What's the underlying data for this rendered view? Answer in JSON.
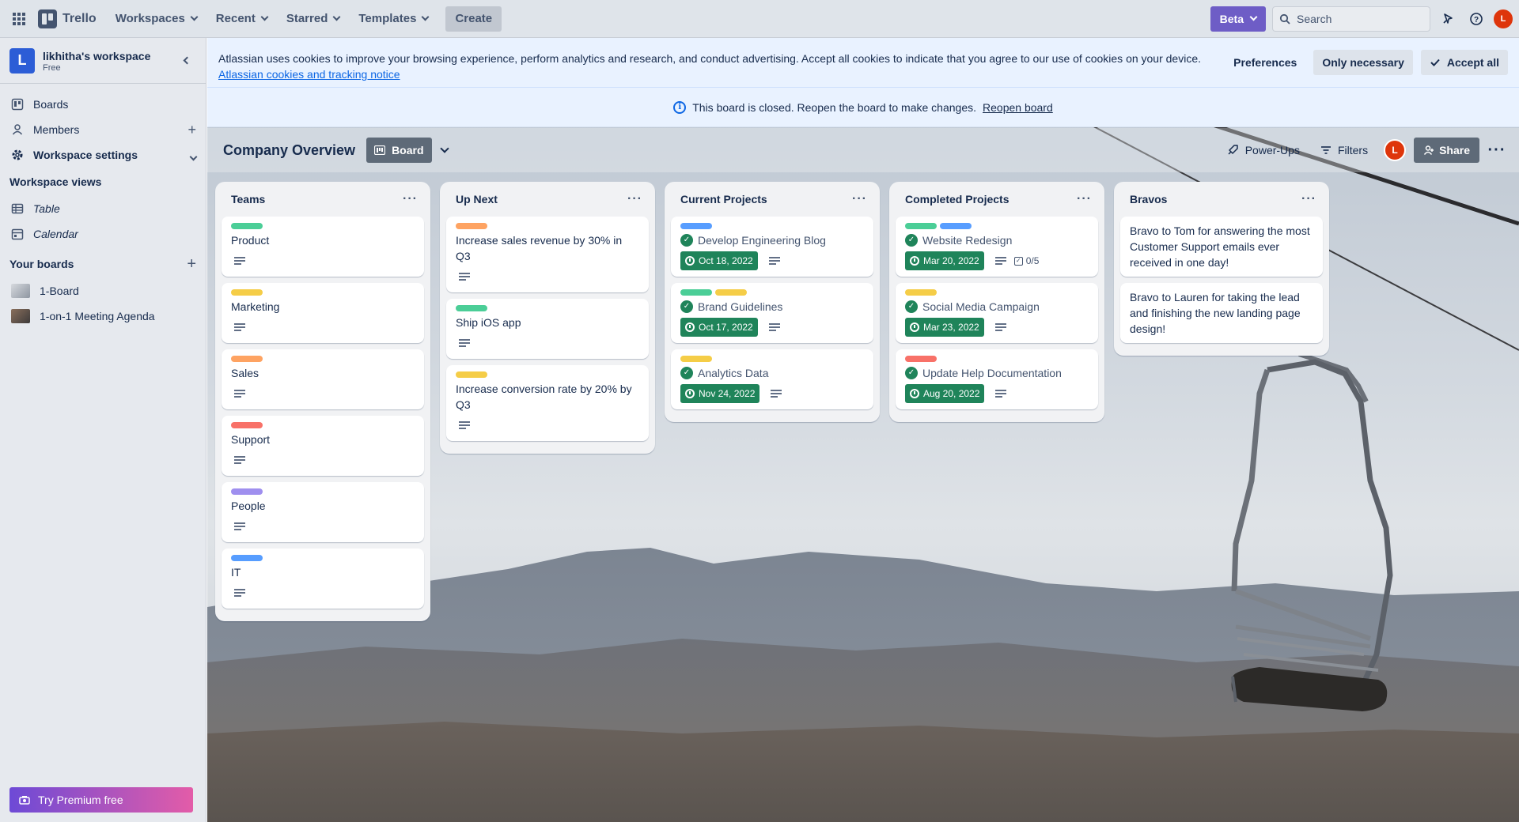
{
  "topbar": {
    "app_name": "Trello",
    "nav": [
      "Workspaces",
      "Recent",
      "Starred",
      "Templates"
    ],
    "create_label": "Create",
    "beta_label": "Beta",
    "search_placeholder": "Search",
    "avatar_initial": "L"
  },
  "sidebar": {
    "workspace_initial": "L",
    "workspace_name": "likhitha's workspace",
    "workspace_plan": "Free",
    "items": [
      {
        "label": "Boards"
      },
      {
        "label": "Members"
      },
      {
        "label": "Workspace settings"
      }
    ],
    "views_heading": "Workspace views",
    "views": [
      {
        "label": "Table"
      },
      {
        "label": "Calendar"
      }
    ],
    "boards_heading": "Your boards",
    "boards": [
      {
        "label": "1-Board"
      },
      {
        "label": "1-on-1 Meeting Agenda"
      }
    ],
    "premium_label": "Try Premium free"
  },
  "cookie": {
    "text": "Atlassian uses cookies to improve your browsing experience, perform analytics and research, and conduct advertising. Accept all cookies to indicate that you agree to our use of cookies on your device.",
    "link": "Atlassian cookies and tracking notice",
    "preferences": "Preferences",
    "only_necessary": "Only necessary",
    "accept_all": "Accept all"
  },
  "closed_banner": {
    "text": "This board is closed. Reopen the board to make changes.",
    "link": "Reopen board"
  },
  "board": {
    "title": "Company Overview",
    "view_label": "Board",
    "powerups": "Power-Ups",
    "filters": "Filters",
    "share": "Share"
  },
  "colors": {
    "green": "#4bce97",
    "yellow": "#f5cd47",
    "orange": "#fea362",
    "red": "#f87168",
    "purple": "#9f8fef",
    "blue": "#579dff",
    "due_complete": "#1f845a"
  },
  "lists": [
    {
      "title": "Teams",
      "cards": [
        {
          "title": "Product",
          "labels": [
            "#4bce97"
          ]
        },
        {
          "title": "Marketing",
          "labels": [
            "#f5cd47"
          ]
        },
        {
          "title": "Sales",
          "labels": [
            "#fea362"
          ]
        },
        {
          "title": "Support",
          "labels": [
            "#f87168"
          ]
        },
        {
          "title": "People",
          "labels": [
            "#9f8fef"
          ]
        },
        {
          "title": "IT",
          "labels": [
            "#579dff"
          ]
        }
      ]
    },
    {
      "title": "Up Next",
      "cards": [
        {
          "title": "Increase sales revenue by 30% in Q3",
          "labels": [
            "#fea362"
          ]
        },
        {
          "title": "Ship iOS app",
          "labels": [
            "#4bce97"
          ]
        },
        {
          "title": "Increase conversion rate by 20% by Q3",
          "labels": [
            "#f5cd47"
          ]
        }
      ]
    },
    {
      "title": "Current Projects",
      "cards": [
        {
          "title": "Develop Engineering Blog",
          "labels": [
            "#579dff"
          ],
          "done": true,
          "due": "Oct 18, 2022"
        },
        {
          "title": "Brand Guidelines",
          "labels": [
            "#4bce97",
            "#f5cd47"
          ],
          "done": true,
          "due": "Oct 17, 2022"
        },
        {
          "title": "Analytics Data",
          "labels": [
            "#f5cd47"
          ],
          "done": true,
          "due": "Nov 24, 2022"
        }
      ]
    },
    {
      "title": "Completed Projects",
      "cards": [
        {
          "title": "Website Redesign",
          "labels": [
            "#4bce97",
            "#579dff"
          ],
          "done": true,
          "due": "Mar 20, 2022",
          "checklist": "0/5"
        },
        {
          "title": "Social Media Campaign",
          "labels": [
            "#f5cd47"
          ],
          "done": true,
          "due": "Mar 23, 2022"
        },
        {
          "title": "Update Help Documentation",
          "labels": [
            "#f87168"
          ],
          "done": true,
          "due": "Aug 20, 2022"
        }
      ]
    },
    {
      "title": "Bravos",
      "cards": [
        {
          "title": "Bravo to Tom for answering the most Customer Support emails ever received in one day!",
          "plain": true
        },
        {
          "title": "Bravo to Lauren for taking the lead and finishing the new landing page design!",
          "plain": true
        }
      ]
    }
  ]
}
